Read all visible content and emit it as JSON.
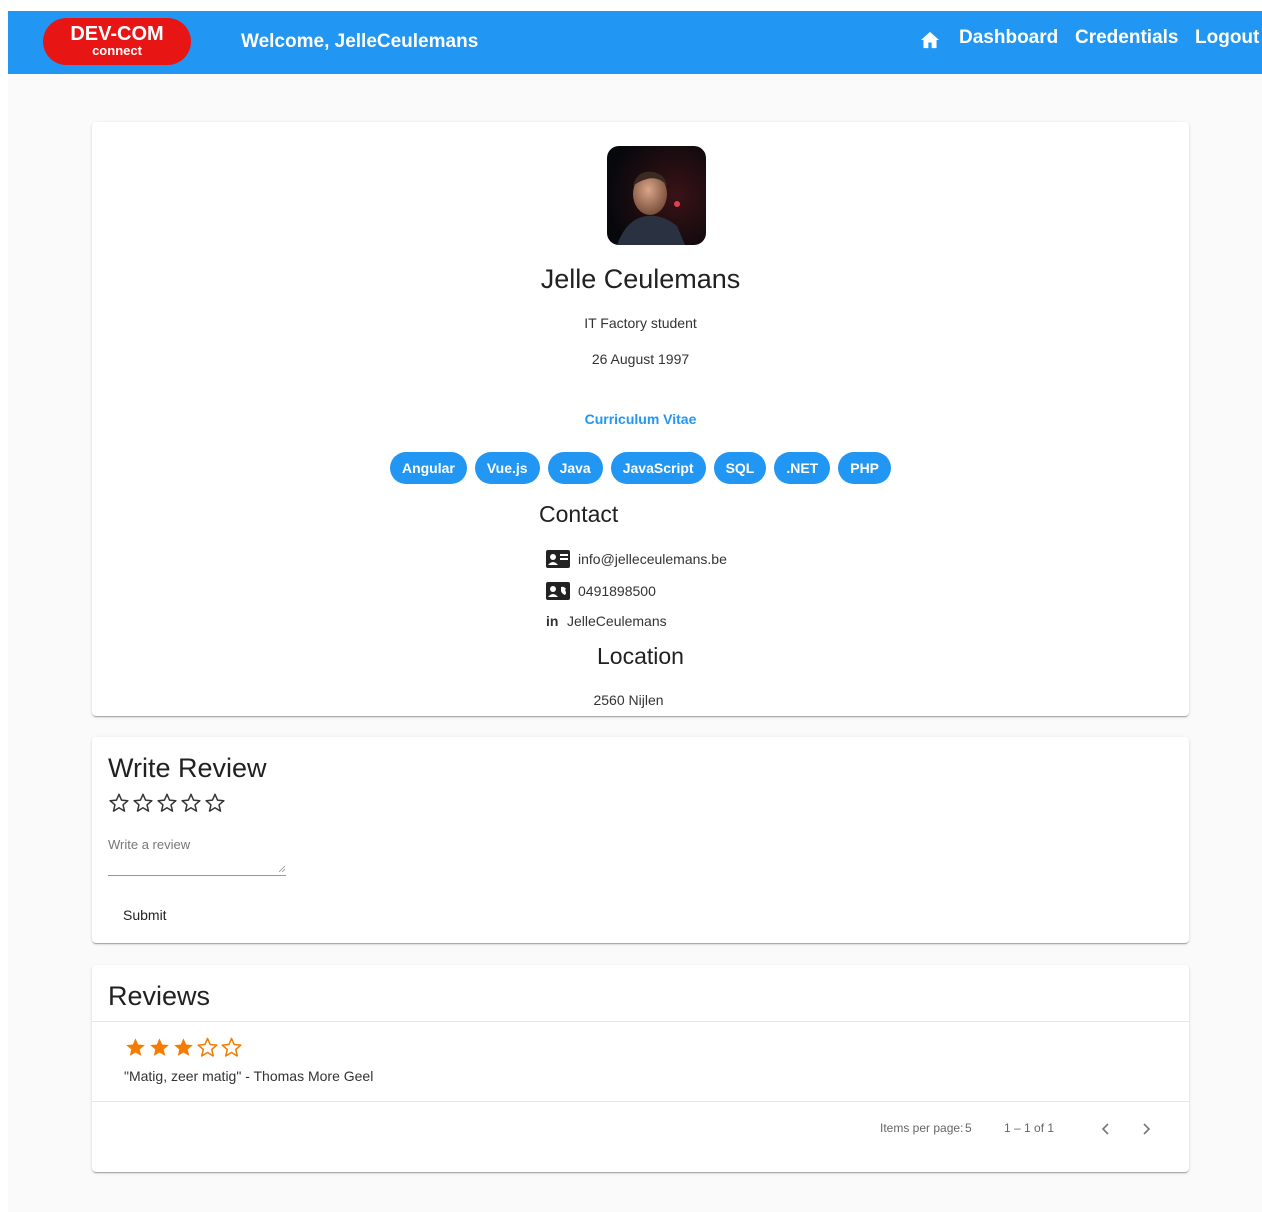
{
  "header": {
    "logo_line1": "DEV-COM",
    "logo_line2": "connect",
    "welcome": "Welcome, JelleCeulemans",
    "nav": [
      "Dashboard",
      "Credentials",
      "Logout"
    ],
    "icon_home": "home-icon",
    "bg_color": "#2196f3",
    "logo_color": "#e81515"
  },
  "profile": {
    "name": "Jelle Ceulemans",
    "subtitle": "IT Factory student",
    "birthdate": "26 August 1997",
    "cv_link": "Curriculum Vitae",
    "skills": [
      "Angular",
      "Vue.js",
      "Java",
      "JavaScript",
      "SQL",
      ".NET",
      "PHP"
    ],
    "contact_heading": "Contact",
    "contact": {
      "email": "info@jelleceulemans.be",
      "phone": "0491898500",
      "linkedin": "JelleCeulemans",
      "linkedin_glyph": "in"
    },
    "location_heading": "Location",
    "location": "2560 Nijlen"
  },
  "write_review": {
    "heading": "Write Review",
    "rating": 0,
    "max_rating": 5,
    "placeholder": "Write a review",
    "submit_label": "Submit"
  },
  "reviews": {
    "heading": "Reviews",
    "items": [
      {
        "rating": 3,
        "max_rating": 5,
        "text": "\"Matig, zeer matig\" - Thomas More Geel"
      }
    ],
    "paginator": {
      "items_per_page_label": "Items per page:",
      "items_per_page": "5",
      "range": "1 – 1 of 1"
    },
    "star_color": "#f57c00"
  }
}
